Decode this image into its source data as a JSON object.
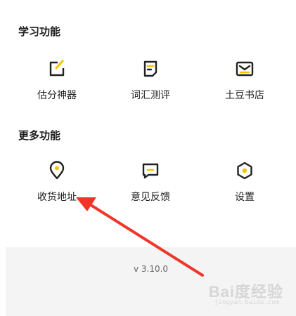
{
  "learning": {
    "title": "学习功能",
    "items": [
      {
        "label": "估分神器",
        "icon": "edit-square-icon"
      },
      {
        "label": "词汇测评",
        "icon": "document-icon"
      },
      {
        "label": "土豆书店",
        "icon": "envelope-icon"
      }
    ]
  },
  "more": {
    "title": "更多功能",
    "items": [
      {
        "label": "收货地址",
        "icon": "location-pin-icon"
      },
      {
        "label": "意见反馈",
        "icon": "message-icon"
      },
      {
        "label": "设置",
        "icon": "hexagon-settings-icon"
      }
    ]
  },
  "footer": {
    "version": "v 3.10.0"
  },
  "watermark": {
    "text": "Bai度经验",
    "sub": "jingyan.baidu.com"
  },
  "colors": {
    "accent": "#F5C400",
    "icon_stroke": "#222222",
    "arrow": "#F0352B",
    "footer_bg": "#F4F4F4"
  }
}
